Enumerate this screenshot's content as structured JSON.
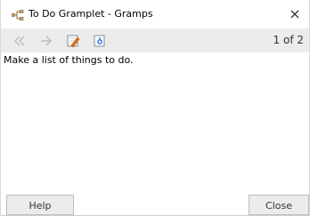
{
  "window": {
    "title": "To Do Gramplet - Gramps",
    "title_icon": "gramps-tree-icon",
    "close_glyph": "×"
  },
  "toolbar": {
    "back_icon": "back-arrow-icon",
    "forward_icon": "forward-arrow-icon",
    "edit_icon": "edit-note-icon",
    "new_icon": "new-note-icon",
    "page_count": "1 of 2"
  },
  "content": {
    "text": "Make a list of things to do."
  },
  "buttons": {
    "help": "Help",
    "close": "Close"
  },
  "colors": {
    "toolbar_bg": "#ececec",
    "button_bg": "#ececec",
    "edit_orange": "#e07020",
    "new_blue": "#2a6fdb"
  }
}
